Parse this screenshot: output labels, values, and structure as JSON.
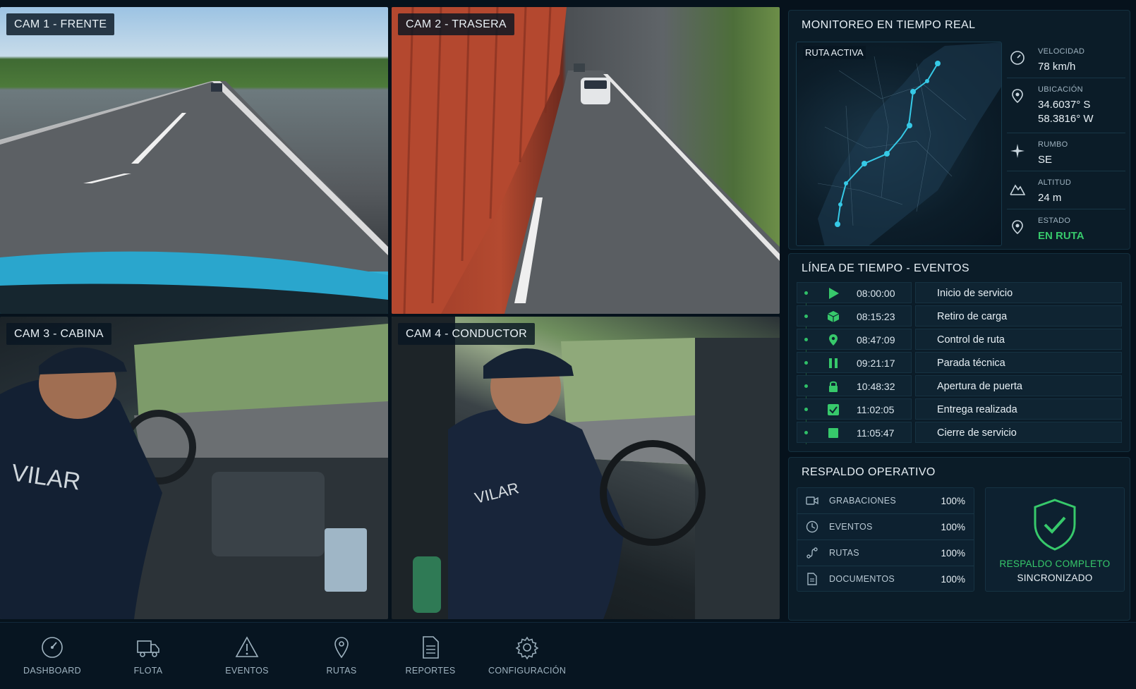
{
  "cameras": [
    {
      "label": "CAM 1 - FRENTE"
    },
    {
      "label": "CAM 2 - TRASERA"
    },
    {
      "label": "CAM 3 - CABINA"
    },
    {
      "label": "CAM 4 - CONDUCTOR"
    }
  ],
  "monitor": {
    "title": "MONITOREO EN TIEMPO REAL",
    "map_label": "RUTA ACTIVA",
    "stats": [
      {
        "key": "VELOCIDAD",
        "value": "78 km/h",
        "icon": "speedometer-icon"
      },
      {
        "key": "UBICACIÓN",
        "value_lat": "34.6037° S",
        "value_lon": "58.3816° W",
        "icon": "location-pin-icon"
      },
      {
        "key": "RUMBO",
        "value": "SE",
        "icon": "compass-icon"
      },
      {
        "key": "ALTITUD",
        "value": "24 m",
        "icon": "mountain-icon"
      },
      {
        "key": "ESTADO",
        "value": "EN RUTA",
        "icon": "status-pin-icon"
      }
    ]
  },
  "timeline": {
    "title": "LÍNEA DE TIEMPO - EVENTOS",
    "events": [
      {
        "time": "08:00:00",
        "label": "Inicio de servicio",
        "icon": "play-icon"
      },
      {
        "time": "08:15:23",
        "label": "Retiro de carga",
        "icon": "box-icon"
      },
      {
        "time": "08:47:09",
        "label": "Control de ruta",
        "icon": "pin-icon"
      },
      {
        "time": "09:21:17",
        "label": "Parada técnica",
        "icon": "pause-icon"
      },
      {
        "time": "10:48:32",
        "label": "Apertura de puerta",
        "icon": "lock-icon"
      },
      {
        "time": "11:02:05",
        "label": "Entrega realizada",
        "icon": "check-icon"
      },
      {
        "time": "11:05:47",
        "label": "Cierre de servicio",
        "icon": "stop-icon"
      }
    ]
  },
  "backup": {
    "title": "RESPALDO OPERATIVO",
    "items": [
      {
        "label": "GRABACIONES",
        "value": "100%",
        "icon": "recording-icon"
      },
      {
        "label": "EVENTOS",
        "value": "100%",
        "icon": "events-icon"
      },
      {
        "label": "RUTAS",
        "value": "100%",
        "icon": "route-icon"
      },
      {
        "label": "DOCUMENTOS",
        "value": "100%",
        "icon": "document-icon"
      }
    ],
    "status_line1": "RESPALDO COMPLETO",
    "status_line2": "SINCRONIZADO"
  },
  "nav": [
    {
      "label": "DASHBOARD",
      "icon": "dashboard-icon"
    },
    {
      "label": "FLOTA",
      "icon": "truck-icon"
    },
    {
      "label": "EVENTOS",
      "icon": "warning-icon"
    },
    {
      "label": "RUTAS",
      "icon": "map-pin-icon"
    },
    {
      "label": "REPORTES",
      "icon": "report-icon"
    },
    {
      "label": "CONFIGURACIÓN",
      "icon": "gear-icon"
    }
  ],
  "colors": {
    "accent_green": "#37c96b",
    "route_cyan": "#36c9e6",
    "panel_bg": "#0b1c28"
  }
}
